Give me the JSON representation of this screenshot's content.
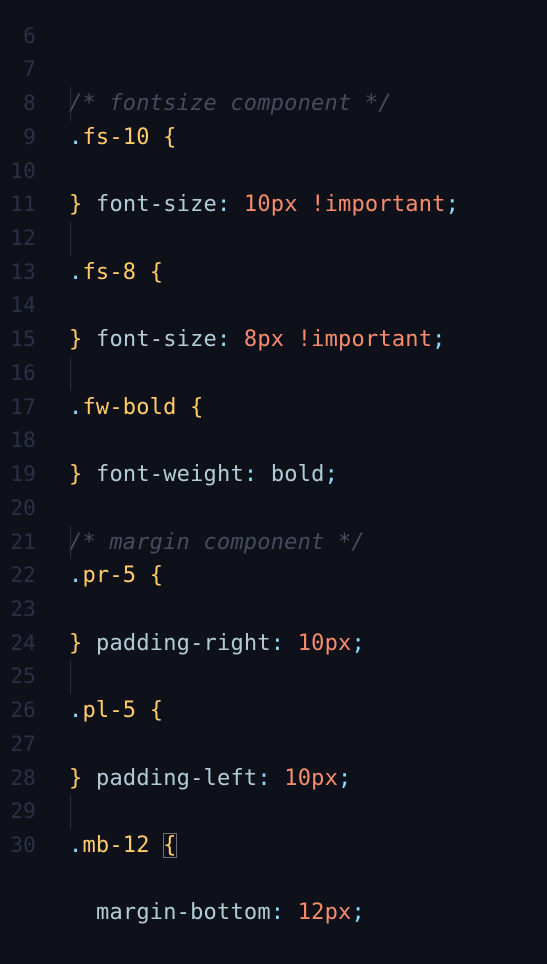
{
  "editor": {
    "lines": [
      {
        "num": "6"
      },
      {
        "num": "7",
        "comment": "/* fontsize component */"
      },
      {
        "num": "8",
        "selector": ".fs-10",
        "brace": "{"
      },
      {
        "num": "9",
        "prop": "font-size",
        "value": "10px",
        "imp": "!important"
      },
      {
        "num": "10",
        "brace": "}"
      },
      {
        "num": "11"
      },
      {
        "num": "12",
        "selector": ".fs-8",
        "brace": "{"
      },
      {
        "num": "13",
        "prop": "font-size",
        "value": "8px",
        "imp": "!important"
      },
      {
        "num": "14",
        "brace": "}"
      },
      {
        "num": "15"
      },
      {
        "num": "16",
        "selector": ".fw-bold",
        "brace": "{"
      },
      {
        "num": "17",
        "prop": "font-weight",
        "value": "bold"
      },
      {
        "num": "18",
        "brace": "}"
      },
      {
        "num": "19"
      },
      {
        "num": "20",
        "comment": "/* margin component */"
      },
      {
        "num": "21",
        "selector": ".pr-5",
        "brace": "{"
      },
      {
        "num": "22",
        "prop": "padding-right",
        "value": "10px"
      },
      {
        "num": "23",
        "brace": "}"
      },
      {
        "num": "24"
      },
      {
        "num": "25",
        "selector": ".pl-5",
        "brace": "{"
      },
      {
        "num": "26",
        "prop": "padding-left",
        "value": "10px"
      },
      {
        "num": "27",
        "brace": "}"
      },
      {
        "num": "28"
      },
      {
        "num": "29",
        "selector": ".mb-12",
        "brace": "{"
      },
      {
        "num": "30",
        "prop": "margin-bottom",
        "value": "12px"
      }
    ]
  },
  "colors": {
    "background": "#0f111a",
    "comment": "#464b5d",
    "selector": "#ffcb6b",
    "property": "#b2ccd6",
    "number": "#f78c6c",
    "punctuation": "#89ddff"
  }
}
